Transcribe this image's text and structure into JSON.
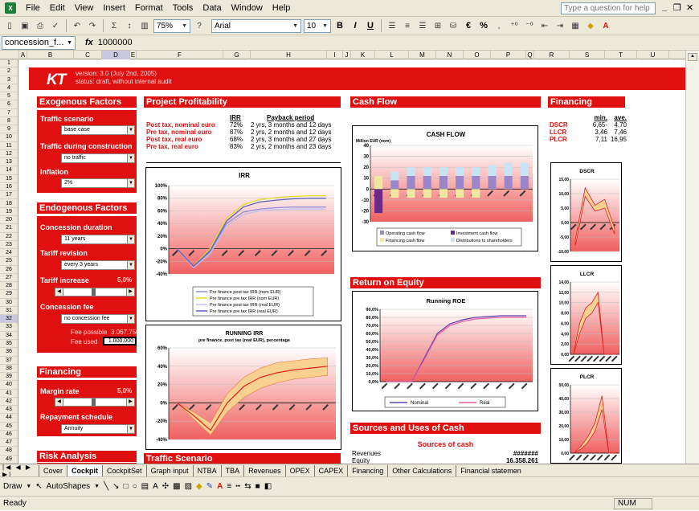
{
  "menu": {
    "items": [
      "File",
      "Edit",
      "View",
      "Insert",
      "Format",
      "Tools",
      "Data",
      "Window",
      "Help"
    ],
    "help_placeholder": "Type a question for help"
  },
  "toolbar": {
    "zoom": "75%",
    "font": "Arial",
    "size": "10",
    "bold": "B",
    "italic": "I",
    "underline": "U",
    "currency": "€",
    "percent": "%"
  },
  "formula": {
    "name_box": "concession_f...",
    "fx": "fx",
    "value": "1000000"
  },
  "columns": [
    "A",
    "B",
    "C",
    "D",
    "E",
    "F",
    "G",
    "H",
    "I",
    "J",
    "K",
    "L",
    "M",
    "N",
    "O",
    "P",
    "Q",
    "R",
    "S",
    "T",
    "U"
  ],
  "banner": {
    "version": "version:  3.0 (July 2nd, 2005)",
    "status": "status:  draft, without internal audit"
  },
  "sections": {
    "exogenous": "Exogenous Factors",
    "endogenous": "Endogenous Factors",
    "financing": "Financing",
    "risk": "Risk Analysis",
    "profitability": "Project Profitability",
    "cashflow": "Cash Flow",
    "financing_right": "Financing",
    "roe": "Return on Equity",
    "sources": "Sources and Uses of Cash",
    "traffic": "Traffic Scenario"
  },
  "exo": {
    "traffic_scenario_label": "Traffic scenario",
    "traffic_scenario_value": "base case",
    "construction_label": "Traffic during construction",
    "construction_value": "no traffic",
    "inflation_label": "Inflation",
    "inflation_value": "2%"
  },
  "endo": {
    "duration_label": "Concession duration",
    "duration_value": "11 years",
    "revision_label": "Tariff revision",
    "revision_value": "every 3 years",
    "increase_label": "Tariff increase",
    "increase_pct": "5,0%",
    "fee_label": "Concession fee",
    "fee_value": "no concession fee",
    "fee_possible_label": "Fee possible",
    "fee_possible_value": "3.067.756",
    "fee_used_label": "Fee used",
    "fee_used_value": "1.000.000"
  },
  "fin": {
    "margin_label": "Margin rate",
    "margin_pct": "5,0%",
    "repayment_label": "Repayment schedule",
    "repayment_value": "Annuity"
  },
  "profit_table": {
    "h_irr": "IRR",
    "h_payback": "Payback period",
    "rows": [
      {
        "label": "Post tax, nominal euro",
        "irr": "72%",
        "pb": "2 yrs, 3 months and 12 days"
      },
      {
        "label": "Pre tax, nominal euro",
        "irr": "87%",
        "pb": "2 yrs, 2 months and 12 days"
      },
      {
        "label": "Post tax, real euro",
        "irr": "68%",
        "pb": "2 yrs, 3 months and 27 days"
      },
      {
        "label": "Pre tax, real euro",
        "irr": "83%",
        "pb": "2 yrs, 2 months and 23 days"
      }
    ]
  },
  "fin_table": {
    "h_min": "min.",
    "h_ave": "ave.",
    "rows": [
      {
        "label": "DSCR",
        "min": "6,65-",
        "ave": "4,70"
      },
      {
        "label": "LLCR",
        "min": "3,46",
        "ave": "7,46"
      },
      {
        "label": "PLCR",
        "min": "7,11",
        "ave": "16,95"
      }
    ]
  },
  "sources_table": {
    "title": "Sources of cash",
    "rows": [
      {
        "label": "Revenues",
        "value": "#######"
      },
      {
        "label": "Equity",
        "value": "16.358.261"
      }
    ]
  },
  "colors": {
    "accent": "#e01010",
    "excel_chrome": "#ece9d8"
  },
  "chart_data": [
    {
      "type": "line",
      "title": "IRR",
      "y_ticks": [
        "100%",
        "80%",
        "60%",
        "40%",
        "20%",
        "0%",
        "-20%",
        "-40%"
      ],
      "x_tick_count": 10,
      "legend": [
        "Pre finance post tax IRR (nom EUR)",
        "Pre finance pre tax IRR (nom EUR)",
        "Pre finance post tax IRR (real EUR)",
        "Pre finance pre tax IRR (real EUR)"
      ],
      "ylim": [
        -40,
        100
      ],
      "series": [
        {
          "name": "Pre finance post tax IRR (nom EUR)",
          "color": "#9090e0",
          "values": [
            0,
            -30,
            -5,
            40,
            58,
            63,
            65,
            66,
            66,
            66
          ]
        },
        {
          "name": "Pre finance pre tax IRR (nom EUR)",
          "color": "#e0e020",
          "values": [
            0,
            -28,
            0,
            48,
            70,
            78,
            81,
            83,
            84,
            84
          ]
        },
        {
          "name": "Pre finance post tax IRR (real EUR)",
          "color": "#c0c0f0",
          "values": [
            0,
            -30,
            -8,
            36,
            54,
            60,
            62,
            63,
            63,
            63
          ]
        },
        {
          "name": "Pre finance pre tax IRR (real EUR)",
          "color": "#6060c0",
          "values": [
            0,
            -28,
            -3,
            44,
            66,
            74,
            77,
            79,
            80,
            80
          ]
        }
      ]
    },
    {
      "type": "area",
      "title": "RUNNING IRR",
      "subtitle": "pre finance, post tax (real EUR), percentage",
      "y_ticks": [
        "60%",
        "40%",
        "20%",
        "0%",
        "-20%",
        "-40%"
      ],
      "ylim": [
        -40,
        60
      ],
      "x_tick_count": 10,
      "series": [
        {
          "name": "upper",
          "values": [
            0,
            -10,
            -22,
            10,
            28,
            38,
            44,
            46,
            48,
            49
          ]
        },
        {
          "name": "mid",
          "values": [
            0,
            -14,
            -30,
            0,
            18,
            28,
            33,
            36,
            38,
            40
          ]
        },
        {
          "name": "lower",
          "values": [
            0,
            -18,
            -35,
            -10,
            6,
            16,
            22,
            26,
            28,
            30
          ]
        }
      ]
    },
    {
      "type": "bar",
      "title": "CASH FLOW",
      "ylabel": "Million EUR (nom)",
      "y_ticks": [
        "40",
        "30",
        "20",
        "10",
        "0",
        "-10",
        "-20",
        "-30"
      ],
      "ylim": [
        -30,
        40
      ],
      "x_tick_count": 10,
      "legend": [
        "Operating cash flow",
        "Investment cash flow",
        "Financing cash flow",
        "Distributions to shareholders"
      ],
      "series": [
        {
          "name": "Operating cash flow",
          "color": "#9a86c8",
          "values": [
            0,
            8,
            12,
            12,
            12,
            12,
            12,
            12,
            12,
            12
          ]
        },
        {
          "name": "Investment cash flow",
          "color": "#6a2a8a",
          "values": [
            -22,
            0,
            0,
            0,
            0,
            0,
            0,
            0,
            0,
            0
          ]
        },
        {
          "name": "Financing cash flow",
          "color": "#f0e8a0",
          "values": [
            12,
            -8,
            -8,
            -8,
            -8,
            -8,
            -8,
            0,
            0,
            0
          ]
        },
        {
          "name": "Distributions to shareholders",
          "color": "#c8e4f4",
          "values": [
            0,
            8,
            8,
            8,
            8,
            8,
            8,
            10,
            12,
            12
          ]
        }
      ]
    },
    {
      "type": "line",
      "title": "Running ROE",
      "y_ticks": [
        "90,0%",
        "80,0%",
        "70,0%",
        "60,0%",
        "50,0%",
        "40,0%",
        "30,0%",
        "20,0%",
        "10,0%",
        "0,0%"
      ],
      "ylim": [
        0,
        90
      ],
      "x_tick_count": 12,
      "legend": [
        "Nominal",
        "Real"
      ],
      "series": [
        {
          "name": "Nominal",
          "color": "#6040b0",
          "values": [
            0,
            0,
            0,
            30,
            60,
            72,
            77,
            80,
            81,
            82,
            82,
            82
          ]
        },
        {
          "name": "Real",
          "color": "#e060a0",
          "values": [
            0,
            0,
            0,
            28,
            58,
            70,
            75,
            78,
            79,
            80,
            80,
            80
          ]
        }
      ]
    },
    {
      "type": "area",
      "title": "DSCR",
      "y_ticks": [
        "15,00",
        "10,00",
        "5,00",
        "0,00",
        "-5,00",
        "-10,00"
      ],
      "ylim": [
        -10,
        15
      ],
      "x_tick_count": 5,
      "series": [
        {
          "name": "upper",
          "values": [
            -6,
            12,
            6,
            8,
            -2
          ]
        },
        {
          "name": "lower",
          "values": [
            -8,
            9,
            4,
            5,
            -4
          ]
        }
      ]
    },
    {
      "type": "area",
      "title": "LLCR",
      "y_ticks": [
        "14,00",
        "12,00",
        "10,00",
        "8,00",
        "6,00",
        "4,00",
        "2,00",
        "0,00"
      ],
      "ylim": [
        0,
        14
      ],
      "x_tick_count": 8,
      "series": [
        {
          "name": "upper",
          "values": [
            0,
            6,
            9,
            10,
            12,
            0,
            0,
            0
          ]
        },
        {
          "name": "lower",
          "values": [
            0,
            4,
            7,
            8,
            10,
            0,
            0,
            0
          ]
        }
      ]
    },
    {
      "type": "area",
      "title": "PLCR",
      "y_ticks": [
        "50,00",
        "40,00",
        "30,00",
        "20,00",
        "10,00",
        "0,00"
      ],
      "ylim": [
        0,
        50
      ],
      "x_tick_count": 7,
      "series": [
        {
          "name": "upper",
          "values": [
            0,
            5,
            12,
            22,
            42,
            0,
            0
          ]
        },
        {
          "name": "lower",
          "values": [
            0,
            3,
            8,
            16,
            32,
            0,
            0
          ]
        }
      ]
    }
  ],
  "tabs": [
    "Cover",
    "Cockpit",
    "CockpitSet",
    "Graph input",
    "NTBA",
    "TBA",
    "Revenues",
    "OPEX",
    "CAPEX",
    "Financing",
    "Other Calculations",
    "Financial statemen"
  ],
  "draw": {
    "draw": "Draw",
    "autoshapes": "AutoShapes"
  },
  "status": {
    "left": "Ready",
    "num": "NUM"
  }
}
